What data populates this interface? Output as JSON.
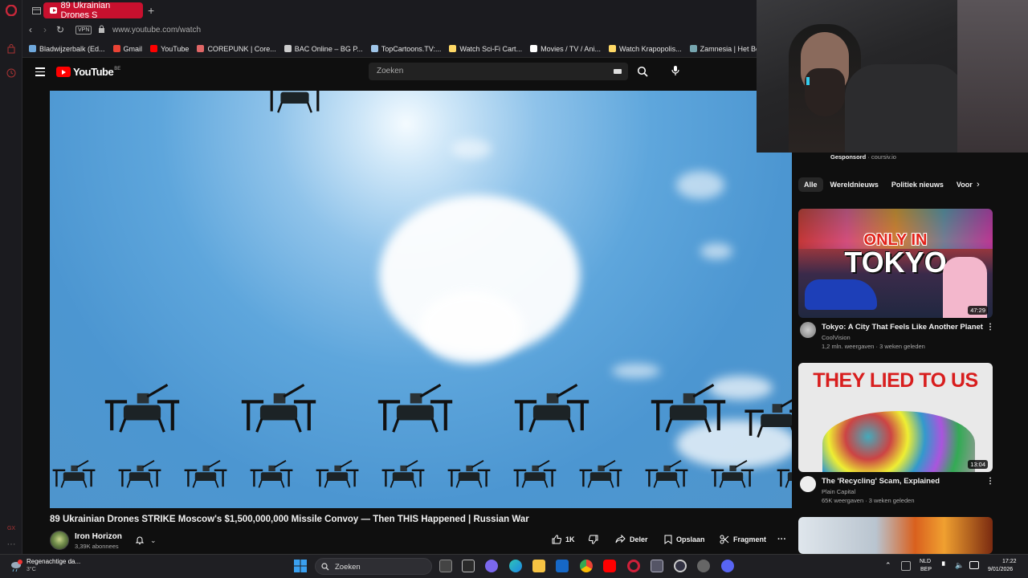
{
  "browser": {
    "tab_title": "89 Ukrainian Drones S",
    "new_tab": "+",
    "vpn_label": "VPN",
    "url": "www.youtube.com/watch",
    "bookmarks": [
      {
        "label": "Bladwijzerbalk (Ed...",
        "color": "#6fa8dc"
      },
      {
        "label": "Gmail",
        "color": "#ea4335"
      },
      {
        "label": "YouTube",
        "color": "#ff0000"
      },
      {
        "label": "COREPUNK | Core...",
        "color": "#e06666"
      },
      {
        "label": "BAC Online – BG P...",
        "color": "#cccccc"
      },
      {
        "label": "TopCartoons.TV:...",
        "color": "#9fc5e8"
      },
      {
        "label": "Watch Sci-Fi Cart...",
        "color": "#ffd966"
      },
      {
        "label": "Movies / TV / Ani...",
        "color": "#ffffff"
      },
      {
        "label": "Watch Krapopolis...",
        "color": "#ffd966"
      },
      {
        "label": "Zamnesia | Het Be",
        "color": "#76a5af"
      }
    ]
  },
  "youtube": {
    "logo_text": "YouTube",
    "country_code": "BE",
    "search_placeholder": "Zoeken"
  },
  "video": {
    "title": "89 Ukrainian Drones STRIKE Moscow's $1,500,000,000 Missile Convoy — Then THIS Happened | Russian War",
    "channel": "Iron Horizon",
    "subscribers": "3,39K abonnees",
    "likes": "1K",
    "share_label": "Deler",
    "save_label": "Opslaan",
    "clip_label": "Fragment",
    "more_label": "···"
  },
  "sidebar": {
    "sponsored": "Gesponsord",
    "sponsor_domain": "coursiv.io",
    "chips": [
      "Alle",
      "Wereldnieuws",
      "Politiek nieuws",
      "Voor"
    ],
    "videos": [
      {
        "title": "Tokyo: A City That Feels Like Another Planet",
        "channel": "CoolVision",
        "meta": "1,2 mln. weergaven · 3 weken geleden",
        "duration": "47:29",
        "thumb_text_1": "ONLY IN",
        "thumb_text_2": "TOKYO"
      },
      {
        "title": "The 'Recycling' Scam, Explained",
        "channel": "Plain Capital",
        "meta": "65K weergaven · 3 weken geleden",
        "duration": "13:04",
        "thumb_text_1": "THEY LIED TO US"
      }
    ]
  },
  "taskbar": {
    "weather": "Regenachtige da...",
    "temp": "3°C",
    "search_label": "Zoeken",
    "lang_1": "NLD",
    "lang_2": "BEP",
    "time": "17:22",
    "date": "9/01/2026"
  },
  "colors": {
    "accent": "#c8102e",
    "youtube_red": "#ff0000",
    "bg": "#0f0f0f"
  }
}
